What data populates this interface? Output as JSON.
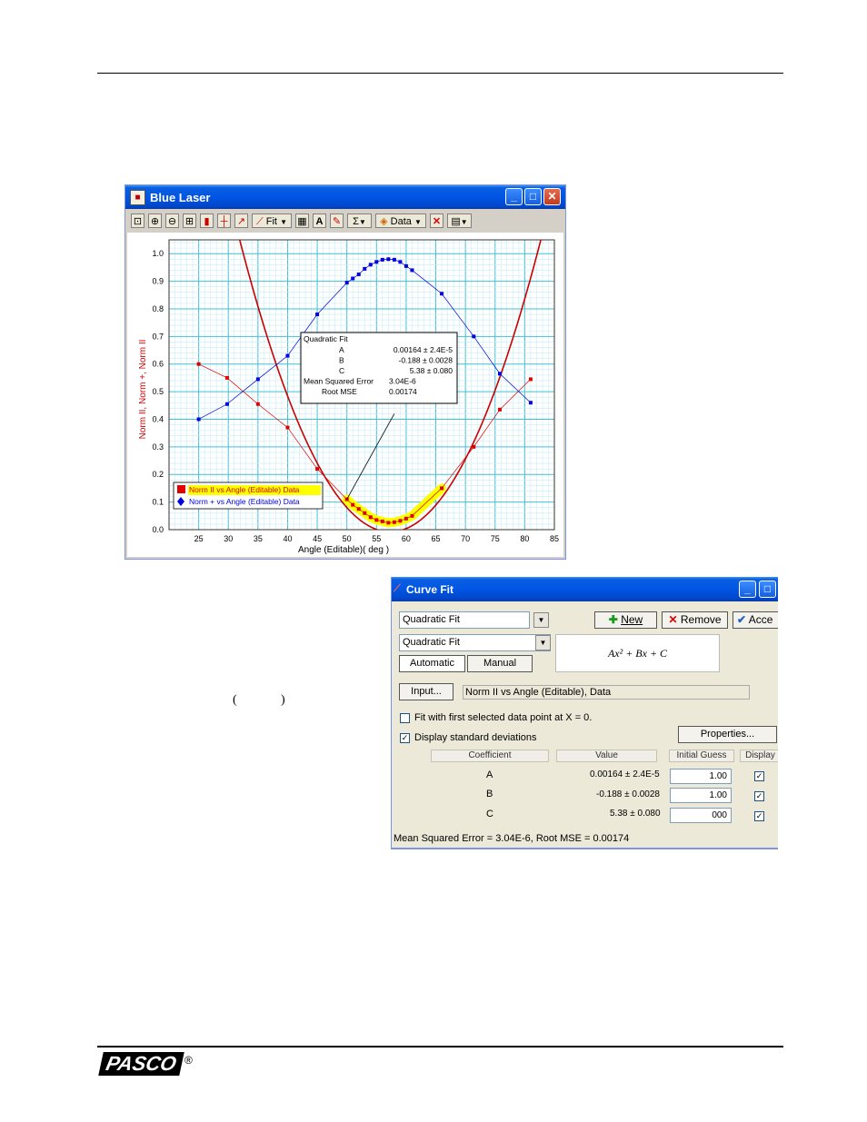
{
  "plot_window": {
    "title": "Blue Laser",
    "toolbar": {
      "fit_label": "Fit",
      "data_label": "Data"
    }
  },
  "chart_data": {
    "type": "scatter",
    "xlabel": "Angle (Editable)( deg )",
    "ylabel": "Norm II, Norm +, Norm II",
    "xlim": [
      20,
      85
    ],
    "ylim": [
      0,
      1.05
    ],
    "x_ticks": [
      25,
      30,
      35,
      40,
      45,
      50,
      55,
      60,
      65,
      70,
      75,
      80,
      85
    ],
    "y_ticks": [
      0.0,
      0.1,
      0.2,
      0.3,
      0.4,
      0.5,
      0.6,
      0.7,
      0.8,
      0.9,
      1.0
    ],
    "series": [
      {
        "name": "Norm II vs Angle (Editable) Data",
        "color": "#e00000",
        "marker": "square",
        "x": [
          25,
          29.8,
          35,
          40,
          45,
          50,
          51,
          52,
          53,
          54,
          55,
          56,
          57,
          58,
          59,
          60,
          61,
          66,
          71.4,
          75.8,
          81
        ],
        "y": [
          0.6,
          0.55,
          0.455,
          0.37,
          0.22,
          0.11,
          0.09,
          0.075,
          0.06,
          0.045,
          0.035,
          0.03,
          0.025,
          0.027,
          0.032,
          0.04,
          0.05,
          0.15,
          0.3,
          0.435,
          0.545
        ]
      },
      {
        "name": "Norm + vs Angle (Editable) Data",
        "color": "#0000e0",
        "marker": "diamond",
        "x": [
          25,
          29.8,
          35,
          40,
          45,
          50,
          51,
          52,
          53,
          54,
          55,
          56,
          57,
          58,
          59,
          60,
          61,
          66,
          71.4,
          75.8,
          81
        ],
        "y": [
          0.4,
          0.455,
          0.545,
          0.63,
          0.78,
          0.895,
          0.91,
          0.925,
          0.945,
          0.96,
          0.97,
          0.978,
          0.98,
          0.978,
          0.97,
          0.955,
          0.94,
          0.855,
          0.7,
          0.565,
          0.46
        ]
      }
    ],
    "fit": {
      "type": "quadratic",
      "A": 0.00164,
      "B": -0.188,
      "C": 5.38,
      "color": "#cc0000"
    },
    "highlight_x_range": [
      50,
      66
    ],
    "fit_box": {
      "title": "Quadratic Fit",
      "rows": [
        {
          "label": "A",
          "value": "0.00164 ± 2.4E-5"
        },
        {
          "label": "B",
          "value": "-0.188 ± 0.0028"
        },
        {
          "label": "C",
          "value": "5.38 ± 0.080"
        },
        {
          "label": "Mean Squared Error",
          "value": "3.04E-6"
        },
        {
          "label": "Root MSE",
          "value": "0.00174"
        }
      ]
    },
    "grid": true,
    "legend_position": "bottom-left"
  },
  "curve_fit": {
    "title": "Curve Fit",
    "fit_select": "Quadratic Fit",
    "fit_type_select": "Quadratic Fit",
    "new_label": "New",
    "remove_label": "Remove",
    "accept_label": "Acce",
    "tab_automatic": "Automatic",
    "tab_manual": "Manual",
    "equation": "Ax² + Bx + C",
    "input_label": "Input...",
    "input_value": "Norm II vs Angle (Editable), Data",
    "fit_first_label": "Fit with first selected data point at X = 0.",
    "display_std_label": "Display standard deviations",
    "properties_label": "Properties...",
    "headers": {
      "coefficient": "Coefficient",
      "value": "Value",
      "initial_guess": "Initial Guess",
      "display": "Display"
    },
    "rows": [
      {
        "coef": "A",
        "value": "0.00164 ± 2.4E-5",
        "guess": "1.00"
      },
      {
        "coef": "B",
        "value": "-0.188 ± 0.0028",
        "guess": "1.00"
      },
      {
        "coef": "C",
        "value": "5.38 ± 0.080",
        "guess": "000"
      }
    ],
    "status": "Mean Squared Error = 3.04E-6, Root MSE = 0.00174"
  },
  "page": {
    "left_paren": "(",
    "right_paren": ")",
    "logo": "PASCO",
    "reg_mark": "®"
  }
}
